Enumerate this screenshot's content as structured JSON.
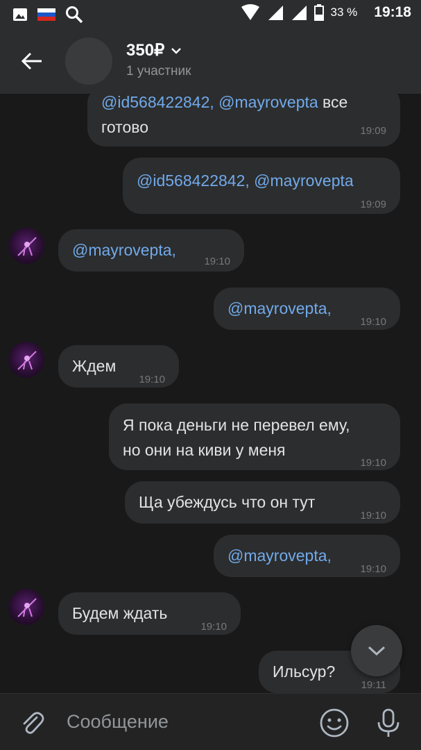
{
  "status_bar": {
    "battery_percent": "33 %",
    "time": "19:18"
  },
  "header": {
    "title": "350₽",
    "subtitle": "1 участник"
  },
  "messages": [
    {
      "side": "out",
      "mention": "@id568422842, @mayrovepta",
      "text": " все",
      "line2": "готово",
      "time": "19:09"
    },
    {
      "side": "out",
      "mention": "@id568422842, @mayrovepta",
      "text": "",
      "time": "19:09"
    },
    {
      "side": "in",
      "mention": "@mayrovepta,",
      "text": "",
      "time": "19:10"
    },
    {
      "side": "out",
      "mention": "@mayrovepta,",
      "text": "",
      "time": "19:10"
    },
    {
      "side": "in",
      "mention": "",
      "text": "Ждем",
      "time": "19:10"
    },
    {
      "side": "out",
      "mention": "",
      "text": "Я пока деньги не перевел ему,",
      "line2": "но они на киви у меня",
      "time": "19:10"
    },
    {
      "side": "out",
      "mention": "",
      "text": "Ща убеждусь что он тут",
      "time": "19:10"
    },
    {
      "side": "out",
      "mention": "@mayrovepta,",
      "text": "",
      "time": "19:10"
    },
    {
      "side": "in",
      "mention": "",
      "text": "Будем ждать",
      "time": "19:10"
    },
    {
      "side": "out",
      "mention": "",
      "text": "Ильсур?",
      "time": "19:11"
    }
  ],
  "composer": {
    "placeholder": "Сообщение"
  },
  "icons": {
    "back": "arrow-left-icon",
    "attach": "paperclip-icon",
    "emoji": "smile-icon",
    "mic": "microphone-icon",
    "scroll_down": "chevron-down-icon"
  },
  "colors": {
    "background": "#19191a",
    "bubble": "#2c2d2e",
    "mention": "#71aaeb",
    "text": "#e1e3e6",
    "secondary": "#939699"
  }
}
